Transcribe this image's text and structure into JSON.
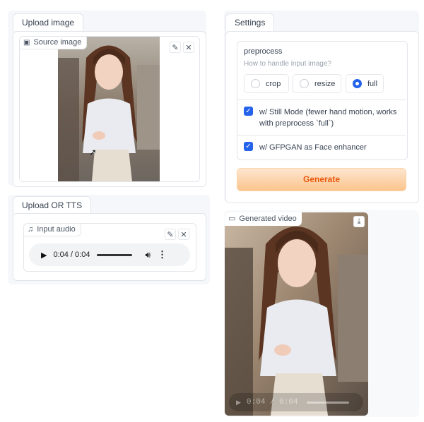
{
  "upload_image": {
    "tab_label": "Upload image",
    "source_chip": "Source image",
    "source_icon": "image-icon",
    "edit_icon": "pencil-icon",
    "clear_icon": "close-icon"
  },
  "upload_tts": {
    "tab_label": "Upload OR TTS",
    "audio_chip": "Input audio",
    "audio_icon": "music-note-icon",
    "player": {
      "time": "0:04 / 0:04"
    }
  },
  "settings": {
    "tab_label": "Settings",
    "preprocess": {
      "label": "preprocess",
      "info": "How to handle input image?",
      "options": [
        "crop",
        "resize",
        "full"
      ],
      "selected": "full"
    },
    "still_mode_label": "w/ Still Mode (fewer hand motion, works with preprocess `full`)",
    "gfpgan_label": "w/ GFPGAN as Face enhancer",
    "generate_label": "Generate"
  },
  "generated": {
    "chip": "Generated video",
    "video_icon": "video-camera-icon",
    "download_icon": "download-icon",
    "time": "0:04 / 0:04"
  },
  "colors": {
    "accent": "#2563eb",
    "generate_bg_start": "#fde1c3",
    "generate_bg_end": "#fbc893",
    "generate_text": "#ea580c"
  }
}
